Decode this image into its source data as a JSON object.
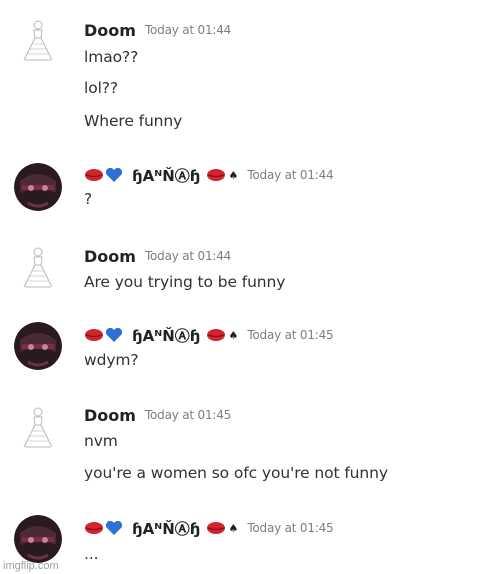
{
  "messages": [
    {
      "author": "Doom",
      "timestamp": "Today at 01:44",
      "lines": [
        "lmao??",
        "lol??",
        "Where funny"
      ]
    },
    {
      "author_display": "ɧAᴺŇⒶɧ",
      "timestamp": "Today at 01:44",
      "lines": [
        "?"
      ]
    },
    {
      "author": "Doom",
      "timestamp": "Today at 01:44",
      "lines": [
        "Are you trying to be funny"
      ]
    },
    {
      "author_display": "ɧAᴺŇⒶɧ",
      "timestamp": "Today at 01:45",
      "lines": [
        "wdym?"
      ]
    },
    {
      "author": "Doom",
      "timestamp": "Today at 01:45",
      "lines": [
        "nvm",
        "you're a women so ofc you're not funny"
      ]
    },
    {
      "author_display": "ɧAᴺŇⒶɧ",
      "timestamp": "Today at 01:45",
      "lines": [
        "..."
      ]
    }
  ],
  "watermark": "imgflip.com",
  "icons": {
    "lips": "lips-emoji",
    "heart": "blue-heart-emoji",
    "spade": "spade-icon"
  },
  "colors": {
    "lips": "#d1252f",
    "heart": "#2f6fd6"
  }
}
